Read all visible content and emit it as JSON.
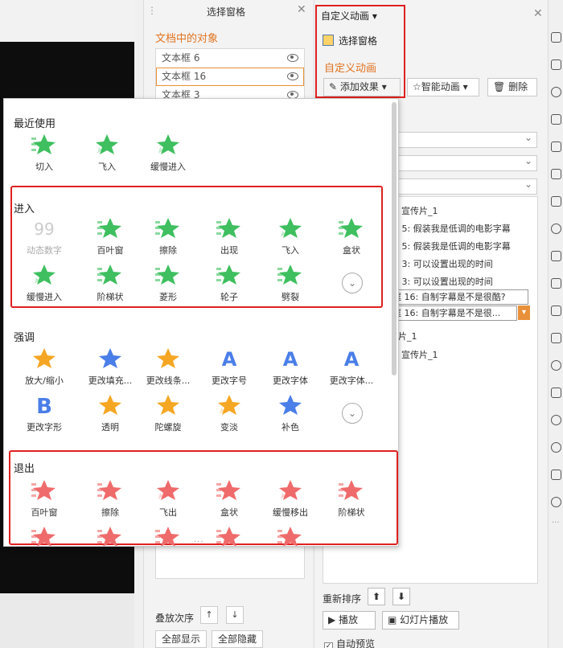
{
  "colors": {
    "accent_orange": "#e07320",
    "highlight_red": "#e02020",
    "enter_green": "#3fbf5f",
    "emphasis_orange": "#f5a623",
    "emphasis_blue": "#4a7ee8",
    "exit_red": "#ef6b6b"
  },
  "selection_pane": {
    "title": "选择窗格",
    "heading": "文档中的对象",
    "objects": [
      {
        "label": "文本框 6"
      },
      {
        "label": "文本框 16",
        "selected": true
      },
      {
        "label": "文本框 3"
      }
    ],
    "layer_order_label": "叠放次序",
    "show_all": "全部显示",
    "hide_all": "全部隐藏"
  },
  "anim_pane": {
    "title": "自定义动画 ▾",
    "selection_pane_link": "选择窗格",
    "heading": "自定义动画",
    "add_effect": "添加效果",
    "smart_animation": "智能动画",
    "delete": "删除",
    "list_items": [
      "宣传片_1",
      "框 5: 假装我是低调的电影字幕",
      "框 5: 假装我是低调的电影字幕",
      "框 3: 可以设置出现的时间",
      "框 3: 可以设置出现的时间",
      "框 16: 自制字幕是不是很酷?",
      "框 16: 自制字幕是不是很...",
      "片_1",
      "宣传片_1"
    ],
    "reorder_label": "重新排序",
    "play": "播放",
    "slideshow": "幻灯片播放",
    "auto_preview": "自动预览"
  },
  "popup": {
    "recent": {
      "title": "最近使用",
      "items": [
        {
          "label": "切入",
          "icon": "cut-in-star-icon"
        },
        {
          "label": "飞入",
          "icon": "fly-in-star-icon"
        },
        {
          "label": "缓慢进入",
          "icon": "slow-in-star-icon"
        }
      ]
    },
    "enter": {
      "title": "进入",
      "items": [
        {
          "label": "动态数字",
          "icon": "dynamic-number-icon",
          "disabled": true
        },
        {
          "label": "百叶窗",
          "icon": "blinds-star-icon"
        },
        {
          "label": "擦除",
          "icon": "wipe-star-icon"
        },
        {
          "label": "出现",
          "icon": "appear-star-icon"
        },
        {
          "label": "飞入",
          "icon": "fly-in-star-icon"
        },
        {
          "label": "盒状",
          "icon": "box-star-icon"
        },
        {
          "label": "缓慢进入",
          "icon": "slow-in-star-icon"
        },
        {
          "label": "阶梯状",
          "icon": "stairs-star-icon"
        },
        {
          "label": "菱形",
          "icon": "diamond-star-icon"
        },
        {
          "label": "轮子",
          "icon": "wheel-star-icon"
        },
        {
          "label": "劈裂",
          "icon": "split-star-icon"
        }
      ]
    },
    "emphasis": {
      "title": "强调",
      "items": [
        {
          "label": "放大/缩小",
          "icon": "grow-shrink-icon"
        },
        {
          "label": "更改填充...",
          "icon": "fill-color-icon"
        },
        {
          "label": "更改线条...",
          "icon": "line-color-icon"
        },
        {
          "label": "更改字号",
          "icon": "font-size-icon"
        },
        {
          "label": "更改字体",
          "icon": "font-icon"
        },
        {
          "label": "更改字体...",
          "icon": "font-color-icon"
        },
        {
          "label": "更改字形",
          "icon": "font-style-icon"
        },
        {
          "label": "透明",
          "icon": "transparency-icon"
        },
        {
          "label": "陀螺旋",
          "icon": "spin-icon"
        },
        {
          "label": "变淡",
          "icon": "fade-icon"
        },
        {
          "label": "补色",
          "icon": "complementary-color-icon"
        }
      ]
    },
    "exit": {
      "title": "退出",
      "items": [
        {
          "label": "百叶窗",
          "icon": "exit-blinds-icon"
        },
        {
          "label": "擦除",
          "icon": "exit-wipe-icon"
        },
        {
          "label": "飞出",
          "icon": "exit-fly-out-icon"
        },
        {
          "label": "盒状",
          "icon": "exit-box-icon"
        },
        {
          "label": "缓慢移出",
          "icon": "exit-slow-out-icon"
        },
        {
          "label": "阶梯状",
          "icon": "exit-stairs-icon"
        }
      ]
    }
  }
}
